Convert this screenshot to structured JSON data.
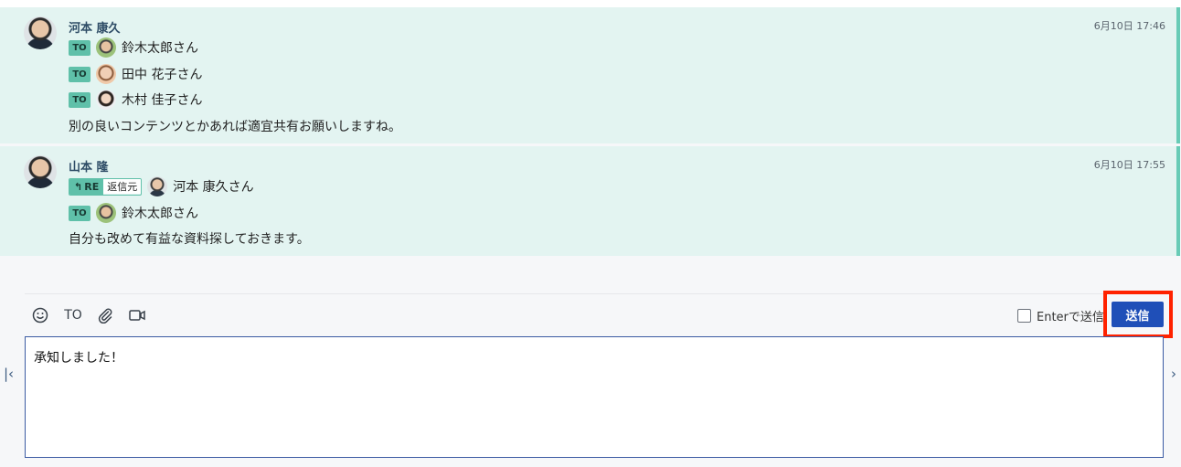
{
  "messages": [
    {
      "sender": "河本 康久",
      "time": "6月10日 17:46",
      "to": [
        {
          "badge": "TO",
          "name": "鈴木太郎さん"
        },
        {
          "badge": "TO",
          "name": "田中 花子さん"
        },
        {
          "badge": "TO",
          "name": "木村 佳子さん"
        }
      ],
      "body": "別の良いコンテンツとかあれば適宜共有お願いしますね。"
    },
    {
      "sender": "山本 隆",
      "time": "6月10日 17:55",
      "reply": {
        "badge": "RE",
        "source_label": "返信元",
        "name": "河本 康久さん"
      },
      "to": [
        {
          "badge": "TO",
          "name": "鈴木太郎さん"
        }
      ],
      "body": "自分も改めて有益な資料探しておきます。"
    }
  ],
  "toolbar": {
    "emoji_icon": "smile-icon",
    "to_label": "TO",
    "attach_icon": "paperclip-icon",
    "video_icon": "video-icon",
    "enter_send_label": "Enterで送信",
    "send_label": "送信"
  },
  "compose": {
    "value": "承知しました！"
  },
  "nav": {
    "left_icon": "collapse-left-icon",
    "right_icon": "chevron-right-icon"
  },
  "colors": {
    "message_bg": "#e3f4f1",
    "badge": "#5fc0a9",
    "send_button": "#1f4fb8",
    "highlight": "#ff2200"
  }
}
